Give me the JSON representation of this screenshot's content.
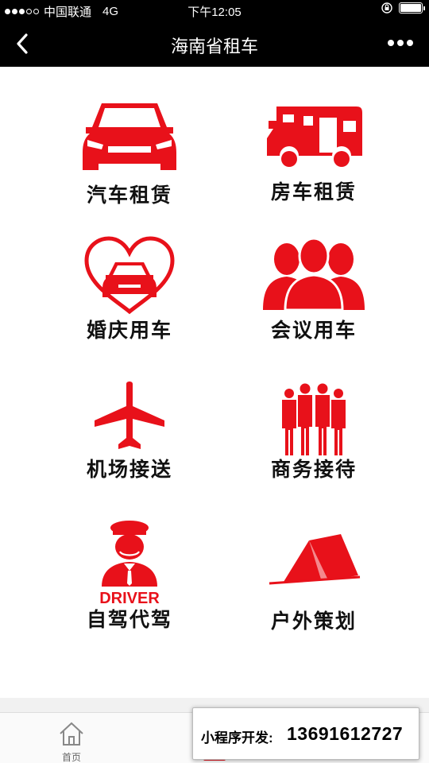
{
  "status_bar": {
    "carrier": "中国联通",
    "network": "4G",
    "time": "下午12:05"
  },
  "nav": {
    "title": "海南省租车"
  },
  "services": [
    {
      "label": "汽车租赁",
      "icon": "car-icon"
    },
    {
      "label": "房车租赁",
      "icon": "rv-icon"
    },
    {
      "label": "婚庆用车",
      "icon": "heart-car-icon"
    },
    {
      "label": "会议用车",
      "icon": "people-group-icon"
    },
    {
      "label": "机场接送",
      "icon": "airplane-icon"
    },
    {
      "label": "商务接待",
      "icon": "business-people-icon"
    },
    {
      "label": "自驾代驾",
      "icon": "driver-icon"
    },
    {
      "label": "户外策划",
      "icon": "tent-icon"
    }
  ],
  "driver_icon_text": "DRIVER",
  "tab_bar": {
    "home_label": "首页"
  },
  "dev_badge": {
    "label": "小程序开发:",
    "phone": "13691612727"
  },
  "colors": {
    "accent": "#e8111a",
    "bar": "#000000"
  }
}
